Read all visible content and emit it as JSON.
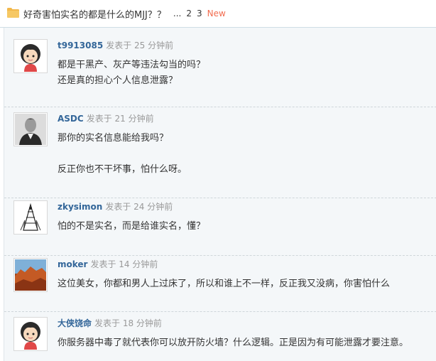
{
  "header": {
    "title": "好奇害怕实名的都是什么的MJJ？？",
    "pages": [
      "...",
      "2",
      "3"
    ],
    "new_label": "New"
  },
  "posts": [
    {
      "author": "t9913085",
      "time": "发表于 25 分钟前",
      "avatar": "cartoon-girl-avatar",
      "lines": [
        "都是干黑产、灰产等违法勾当的吗？",
        "还是真的担心个人信息泄露？"
      ]
    },
    {
      "author": "ASDC",
      "time": "发表于 21 分钟前",
      "avatar": "portrait-avatar",
      "lines": [
        "那你的实名信息能给我吗？",
        "",
        "反正你也不干坏事，怕什么呀。"
      ]
    },
    {
      "author": "zkysimon",
      "time": "发表于 24 分钟前",
      "avatar": "sketch-avatar",
      "lines": [
        "怕的不是实名，而是给谁实名，懂？"
      ]
    },
    {
      "author": "moker",
      "time": "发表于 14 分钟前",
      "avatar": "canyon-avatar",
      "lines": [
        "这位美女，你都和男人上过床了，所以和谁上不一样，反正我又没病，你害怕什么"
      ]
    },
    {
      "author": "大侠饶命",
      "time": "发表于 18 分钟前",
      "avatar": "cartoon-girl-avatar",
      "lines": [
        "你服务器中毒了就代表你可以放开防火墙？什么逻辑。正是因为有可能泄露才要注意。"
      ]
    }
  ]
}
